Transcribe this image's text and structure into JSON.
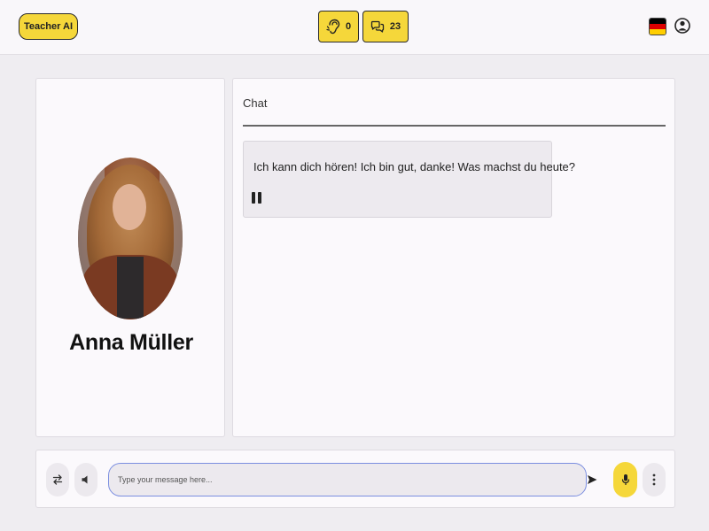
{
  "header": {
    "brand_label": "Teacher AI",
    "listen_count": "0",
    "chat_count": "23",
    "language_flag": "germany-flag",
    "colors": {
      "accent": "#f5d73a",
      "flag": [
        "#000000",
        "#dd0000",
        "#ffce00"
      ]
    }
  },
  "profile": {
    "name": "Anna Müller"
  },
  "chat": {
    "title": "Chat",
    "messages": [
      {
        "text": "Ich kann dich hören! Ich bin gut, danke! Was machst du heute?",
        "audio_state": "playing"
      }
    ]
  },
  "composer": {
    "placeholder": "Type your message here...",
    "value": ""
  },
  "icons": {
    "listen": "ear-icon",
    "chat": "chat-bubbles-icon",
    "profile": "user-circle-icon",
    "swap": "swap-arrows-icon",
    "speaker": "speaker-icon",
    "send": "send-icon",
    "mic": "microphone-icon",
    "more": "more-vertical-icon",
    "pause": "pause-icon"
  }
}
